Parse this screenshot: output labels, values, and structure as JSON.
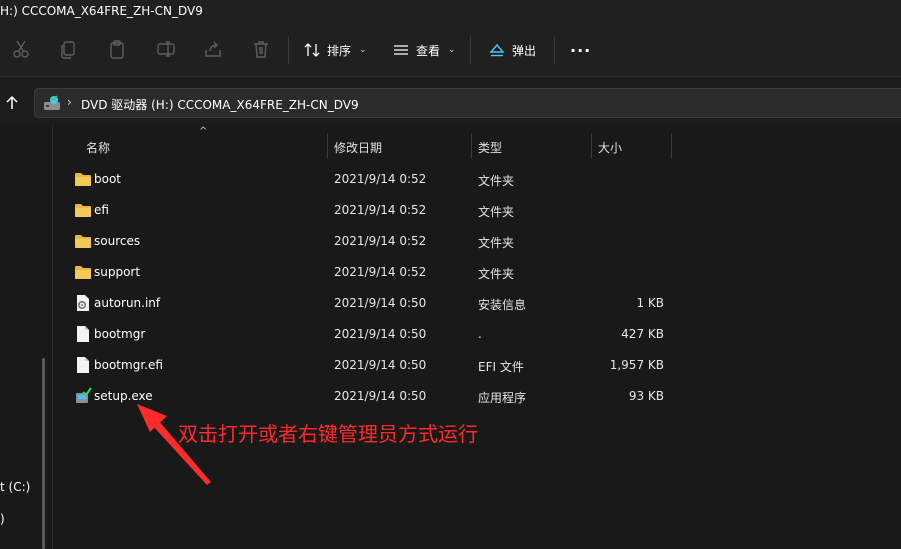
{
  "window": {
    "title_fragment": "H:) CCCOMA_X64FRE_ZH-CN_DV9"
  },
  "toolbar": {
    "icons": [
      "cut-icon",
      "copy-icon",
      "paste-icon",
      "rename-icon",
      "share-icon",
      "delete-icon"
    ],
    "sort_label": "排序",
    "view_label": "查看",
    "eject_label": "弹出",
    "more_label": "···"
  },
  "address": {
    "path": "DVD 驱动器 (H:) CCCOMA_X64FRE_ZH-CN_DV9"
  },
  "left_pane": {
    "item_c": "t (C:)",
    "item_2": ")"
  },
  "columns": {
    "name": "名称",
    "date": "修改日期",
    "type": "类型",
    "size": "大小"
  },
  "files": [
    {
      "name": "boot",
      "date": "2021/9/14 0:52",
      "type": "文件夹",
      "size": "",
      "icon": "folder-icon"
    },
    {
      "name": "efi",
      "date": "2021/9/14 0:52",
      "type": "文件夹",
      "size": "",
      "icon": "folder-icon"
    },
    {
      "name": "sources",
      "date": "2021/9/14 0:52",
      "type": "文件夹",
      "size": "",
      "icon": "folder-icon"
    },
    {
      "name": "support",
      "date": "2021/9/14 0:52",
      "type": "文件夹",
      "size": "",
      "icon": "folder-icon"
    },
    {
      "name": "autorun.inf",
      "date": "2021/9/14 0:50",
      "type": "安装信息",
      "size": "1 KB",
      "icon": "settings-file-icon"
    },
    {
      "name": "bootmgr",
      "date": "2021/9/14 0:50",
      "type": ".",
      "size": "427 KB",
      "icon": "file-icon"
    },
    {
      "name": "bootmgr.efi",
      "date": "2021/9/14 0:50",
      "type": "EFI 文件",
      "size": "1,957 KB",
      "icon": "file-icon"
    },
    {
      "name": "setup.exe",
      "date": "2021/9/14 0:50",
      "type": "应用程序",
      "size": "93 KB",
      "icon": "setup-icon"
    }
  ],
  "annotation": {
    "text": "双击打开或者右键管理员方式运行",
    "color": "#ff2a2a"
  },
  "colors": {
    "background": "#191919",
    "toolbar": "#202020",
    "folder": "#e8b64a",
    "accent": "#4cc2ff"
  }
}
